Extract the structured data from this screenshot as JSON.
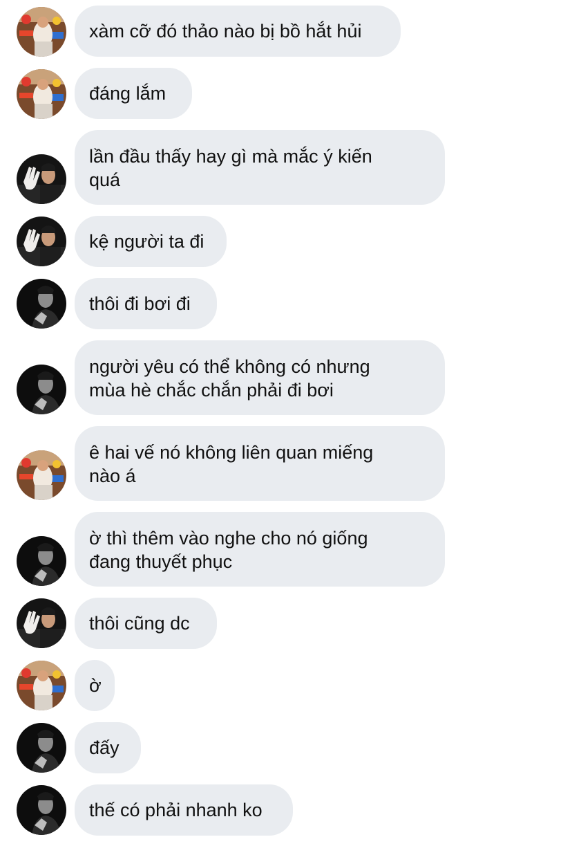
{
  "messages": [
    {
      "sender": "user_a",
      "text": "xàm cỡ đó thảo nào bị bồ hắt hủi"
    },
    {
      "sender": "user_a",
      "text": "đáng lắm"
    },
    {
      "sender": "user_b",
      "text": "lần đầu thấy hay gì mà mắc ý kiến\nquá"
    },
    {
      "sender": "user_b",
      "text": "kệ người ta đi"
    },
    {
      "sender": "user_c",
      "text": "thôi đi bơi đi"
    },
    {
      "sender": "user_c",
      "text": "người yêu có thể không có nhưng\nmùa hè chắc chắn phải đi bơi"
    },
    {
      "sender": "user_a",
      "text": "ê hai vế nó không liên quan miếng\nnào á"
    },
    {
      "sender": "user_c",
      "text": "ờ thì thêm vào nghe cho nó giống\nđang thuyết phục"
    },
    {
      "sender": "user_b",
      "text": "thôi cũng dc"
    },
    {
      "sender": "user_a",
      "text": "ờ"
    },
    {
      "sender": "user_c",
      "text": "đấy"
    },
    {
      "sender": "user_c",
      "text": "thế có phải nhanh ko"
    }
  ],
  "colors": {
    "bubble_bg": "#e9ecf0",
    "text": "#111111",
    "background": "#ffffff"
  },
  "avatars": {
    "user_a": "colorful-photo-avatar",
    "user_b": "waving-hand-photo-avatar",
    "user_c": "dark-portrait-photo-avatar"
  }
}
